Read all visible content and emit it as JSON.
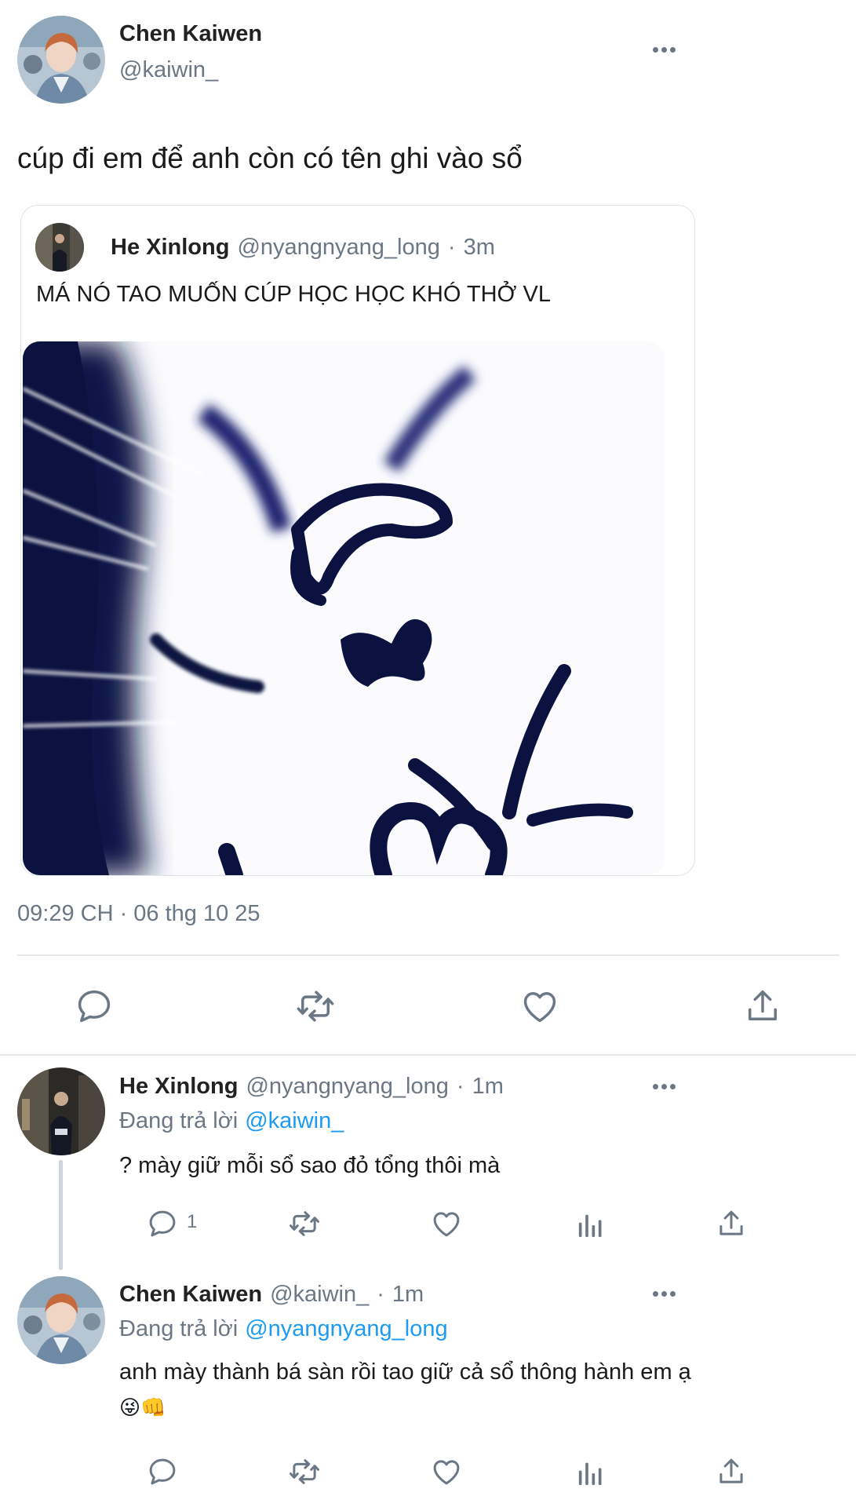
{
  "main_tweet": {
    "author_name": "Chen Kaiwen",
    "author_handle": "@kaiwin_",
    "text": "cúp đi em để anh còn có tên ghi vào sổ",
    "quoted": {
      "author_name": "He Xinlong",
      "author_handle": "@nyangnyang_long",
      "separator": "·",
      "time": "3m",
      "text": "MÁ NÓ TAO MUỐN CÚP HỌC HỌC KHÓ THỞ VL"
    },
    "timestamp": "09:29 CH · 06 thg 10 25",
    "actions": [
      "reply-icon",
      "retweet-icon",
      "like-icon",
      "share-icon"
    ]
  },
  "replies": [
    {
      "author_name": "He Xinlong",
      "author_handle": "@nyangnyang_long",
      "separator": "·",
      "time": "1m",
      "replying_prefix": "Đang trả lời",
      "replying_to": "@kaiwin_",
      "text": "? mày giữ mỗi sổ sao đỏ tổng thôi mà",
      "reply_count": "1"
    },
    {
      "author_name": "Chen Kaiwen",
      "author_handle": "@kaiwin_",
      "separator": "·",
      "time": "1m",
      "replying_prefix": "Đang trả lời",
      "replying_to": "@nyangnyang_long",
      "text": "anh mày thành bá sàn rồi tao giữ cả sổ thông hành em ạ",
      "emoji": "😜👊"
    }
  ],
  "colors": {
    "accent": "#1d9bf0",
    "muted": "#6b7784",
    "meme_ink": "#101646"
  }
}
